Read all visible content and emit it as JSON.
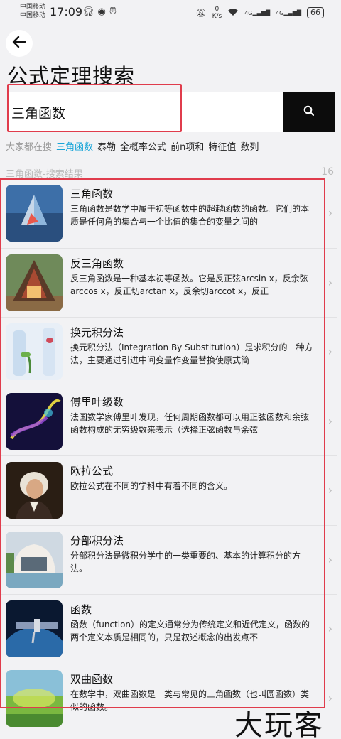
{
  "status_bar": {
    "carrier1": "中国移动",
    "carrier2": "中国移动",
    "time": "17:09",
    "speed_value": "0",
    "speed_unit": "K/s",
    "signal1": "4G",
    "signal2": "4G",
    "battery": "66"
  },
  "header": {
    "back_icon": "arrow-left",
    "title": "公式定理搜索"
  },
  "search": {
    "value": "三角函数",
    "button_icon": "search"
  },
  "hot": {
    "label": "大家都在搜",
    "tags": [
      "三角函数",
      "泰勒",
      "全概率公式",
      "前n项和",
      "特征值",
      "数列"
    ],
    "active_index": 0
  },
  "results": {
    "title": "三角函数-搜索结果",
    "count": "16",
    "items": [
      {
        "title": "三角函数",
        "desc": "三角函数是数学中属于初等函数中的超越函数的函数。它们的本质是任何角的集合与一个比值的集合的变量之间的"
      },
      {
        "title": "反三角函数",
        "desc": "反三角函数是一种基本初等函数。它是反正弦arcsin x，反余弦arccos x，反正切arctan x，反余切arccot x，反正"
      },
      {
        "title": "换元积分法",
        "desc": "换元积分法（Integration By Substitution）是求积分的一种方法，主要通过引进中间变量作变量替换使原式简"
      },
      {
        "title": "傅里叶级数",
        "desc": "法国数学家傅里叶发现，任何周期函数都可以用正弦函数和余弦函数构成的无穷级数来表示（选择正弦函数与余弦"
      },
      {
        "title": "欧拉公式",
        "desc": "欧拉公式在不同的学科中有着不同的含义。"
      },
      {
        "title": "分部积分法",
        "desc": "分部积分法是微积分学中的一类重要的、基本的计算积分的方法。"
      },
      {
        "title": "函数",
        "desc": "函数（function）的定义通常分为传统定义和近代定义，函数的两个定义本质是相同的，只是叙述概念的出发点不"
      },
      {
        "title": "双曲函数",
        "desc": "在数学中，双曲函数是一类与常见的三角函数（也叫圆函数）类似的函数。"
      }
    ]
  },
  "watermark": "大玩客"
}
